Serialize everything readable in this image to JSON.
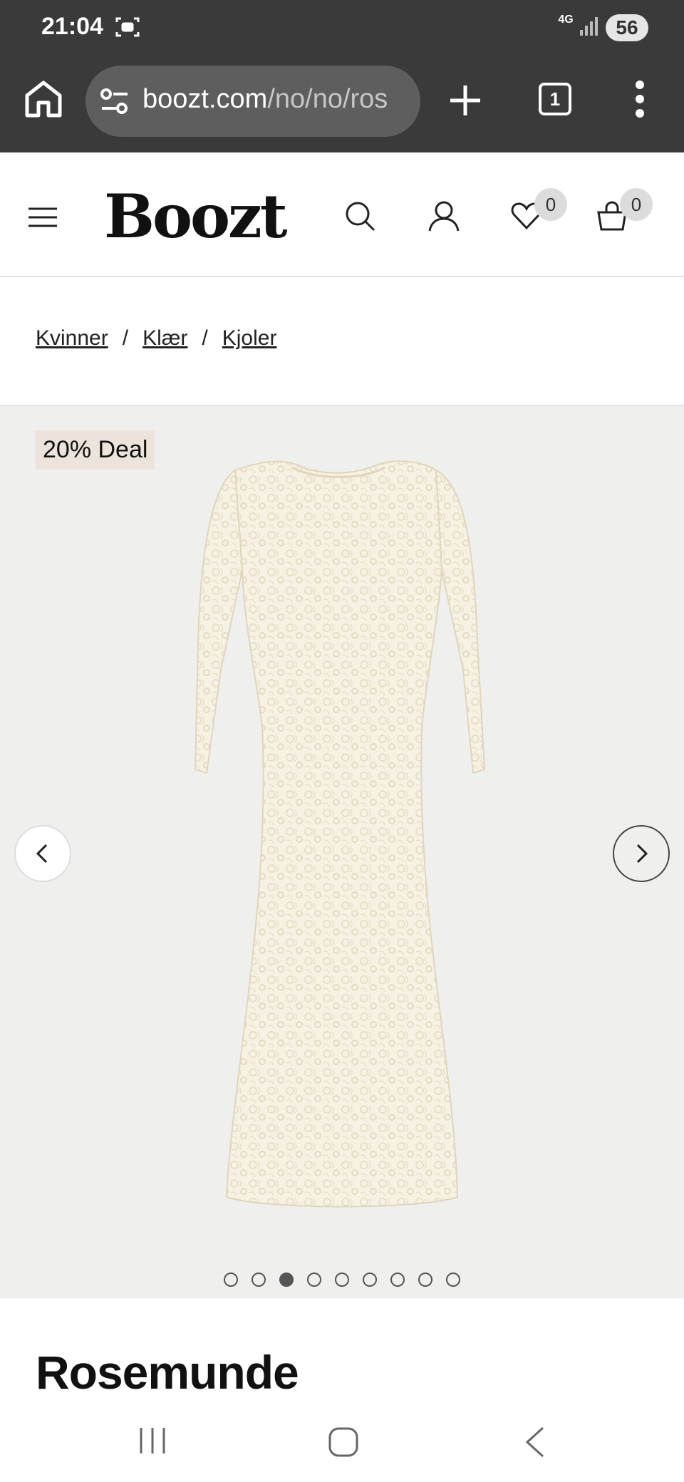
{
  "status_bar": {
    "time": "21:04",
    "network": "4G",
    "battery": "56"
  },
  "browser": {
    "url_domain": "boozt.com",
    "url_path": "/no/no/ros",
    "tab_count": "1"
  },
  "header": {
    "logo": "Boozt",
    "wishlist_count": "0",
    "cart_count": "0"
  },
  "breadcrumb": [
    "Kvinner",
    "Klær",
    "Kjoler"
  ],
  "gallery": {
    "deal_badge": "20% Deal",
    "image_count": 9,
    "active_index": 2
  },
  "product": {
    "brand": "Rosemunde"
  },
  "icons": [
    "screen-record-icon",
    "signal-icon",
    "home-icon",
    "tune-icon",
    "plus-icon",
    "tabs-icon",
    "more-vert-icon",
    "menu-icon",
    "search-icon",
    "user-icon",
    "heart-icon",
    "bag-icon",
    "chevron-left-icon",
    "chevron-right-icon",
    "recent-apps-icon",
    "home-circle-icon",
    "back-icon"
  ]
}
